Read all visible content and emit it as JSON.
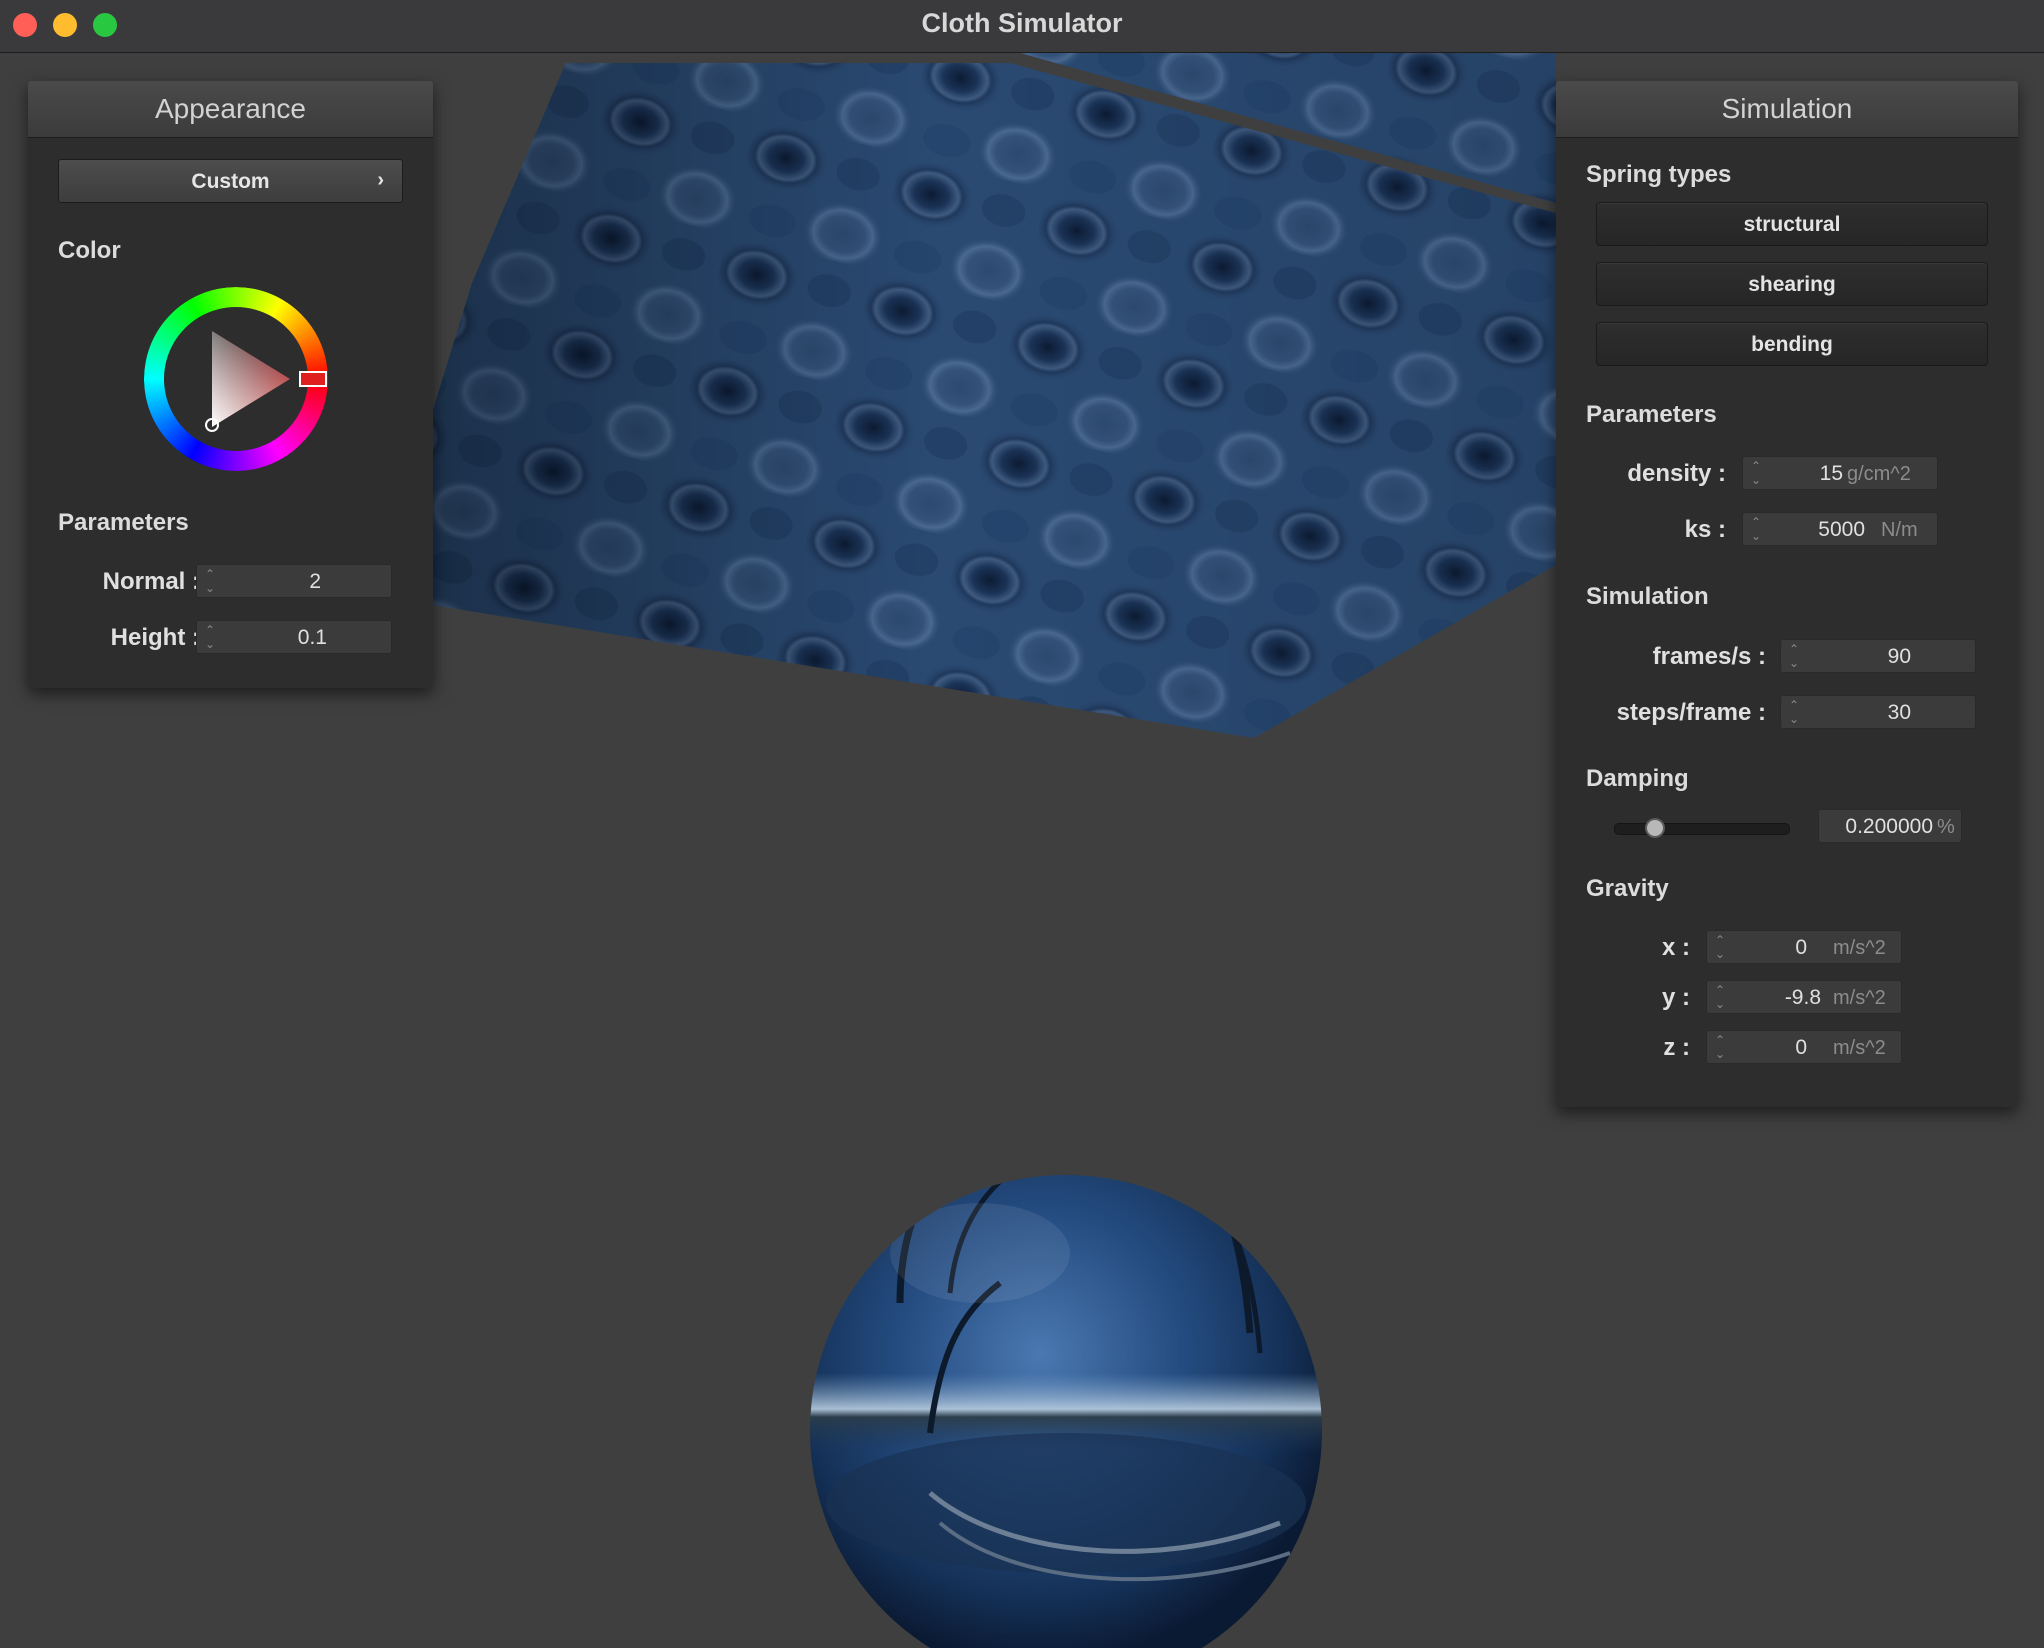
{
  "window": {
    "title": "Cloth Simulator"
  },
  "appearance": {
    "header": "Appearance",
    "preset": "Custom",
    "preset_chevron": "›",
    "color_label": "Color",
    "params_label": "Parameters",
    "normal": {
      "label": "Normal :",
      "value": "2"
    },
    "height": {
      "label": "Height :",
      "value": "0.1"
    },
    "selected_color": "#e02020"
  },
  "simulation": {
    "header": "Simulation",
    "spring_types_label": "Spring types",
    "spring_types": [
      "structural",
      "shearing",
      "bending"
    ],
    "params_label": "Parameters",
    "density": {
      "label": "density :",
      "value": "15",
      "unit": "g/cm^2"
    },
    "ks": {
      "label": "ks :",
      "value": "5000",
      "unit": "N/m"
    },
    "simulation_label": "Simulation",
    "fps": {
      "label": "frames/s :",
      "value": "90"
    },
    "steps": {
      "label": "steps/frame :",
      "value": "30"
    },
    "damping_label": "Damping",
    "damping": {
      "value": "0.200000",
      "unit": "%",
      "fraction": 0.2
    },
    "gravity_label": "Gravity",
    "gravity": {
      "x": {
        "label": "x :",
        "value": "0",
        "unit": "m/s^2"
      },
      "y": {
        "label": "y :",
        "value": "-9.8",
        "unit": "m/s^2"
      },
      "z": {
        "label": "z :",
        "value": "0",
        "unit": "m/s^2"
      }
    }
  },
  "spin_glyphs": {
    "up": "⌃",
    "down": "⌄"
  }
}
